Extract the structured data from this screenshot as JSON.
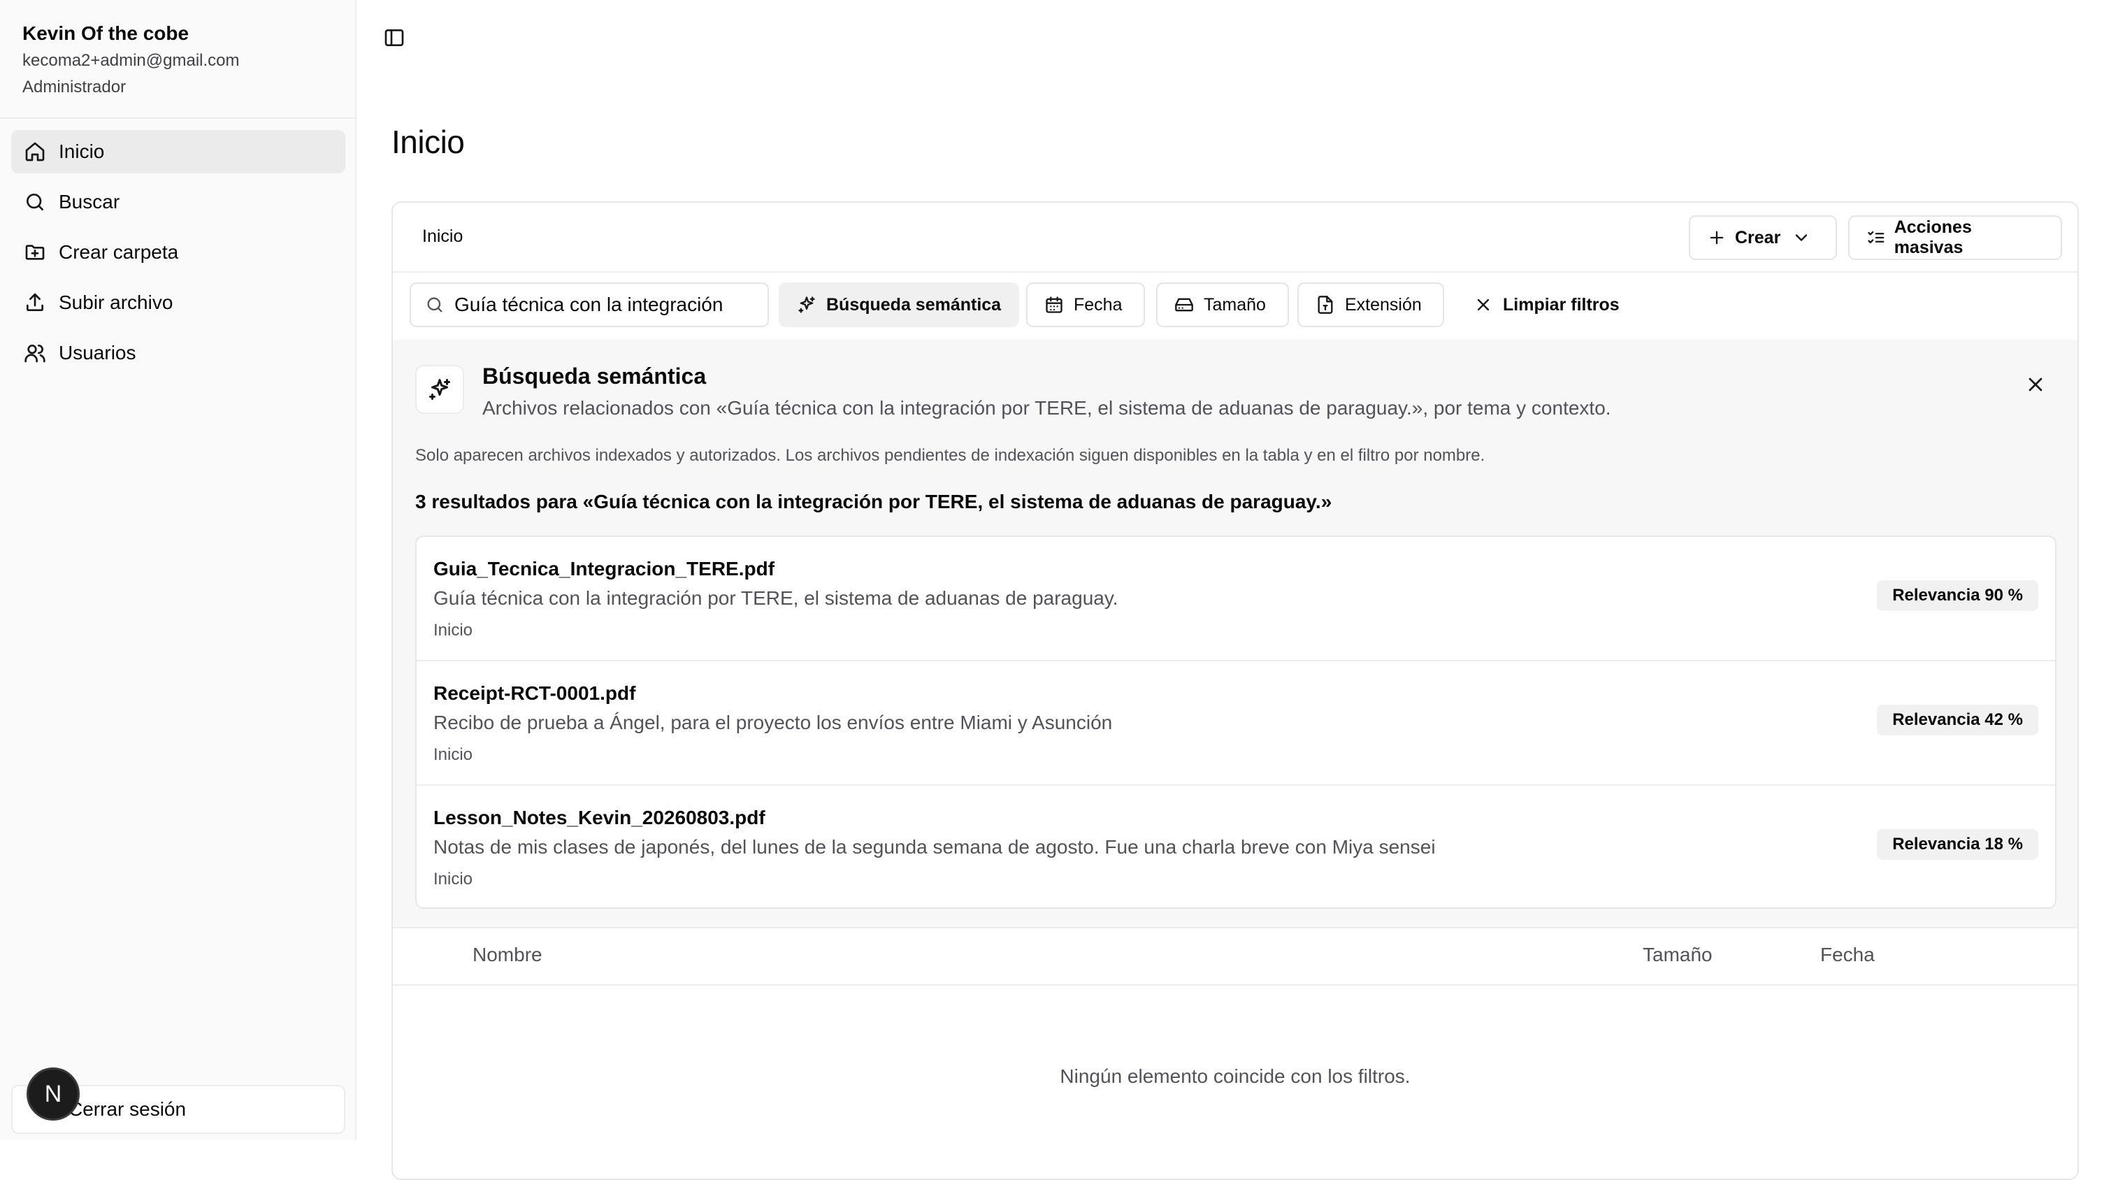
{
  "user": {
    "name": "Kevin Of the cobe",
    "email": "kecoma2+admin@gmail.com",
    "role": "Administrador"
  },
  "sidebar": {
    "items": [
      {
        "label": "Inicio",
        "icon": "home-icon",
        "active": true
      },
      {
        "label": "Buscar",
        "icon": "search-icon"
      },
      {
        "label": "Crear carpeta",
        "icon": "folder-plus-icon"
      },
      {
        "label": "Subir archivo",
        "icon": "upload-icon"
      },
      {
        "label": "Usuarios",
        "icon": "users-icon"
      }
    ],
    "logout_label": "Cerrar sesión",
    "avatar_letter": "N"
  },
  "main": {
    "page_title": "Inicio",
    "breadcrumb": "Inicio",
    "create_label": "Crear",
    "bulk_label": "Acciones masivas",
    "search_value": "Guía técnica con la integración",
    "filters": {
      "semantic": "Búsqueda semántica",
      "date": "Fecha",
      "size": "Tamaño",
      "extension": "Extensión",
      "clear": "Limpiar filtros"
    }
  },
  "semantic": {
    "title": "Búsqueda semántica",
    "subtitle": "Archivos relacionados con «Guía técnica con la integración por TERE, el sistema de aduanas de paraguay.», por tema y contexto.",
    "note": "Solo aparecen archivos indexados y autorizados. Los archivos pendientes de indexación siguen disponibles en la tabla y en el filtro por nombre.",
    "count": "3 resultados para «Guía técnica con la integración por TERE, el sistema de aduanas de paraguay.»",
    "results": [
      {
        "name": "Guia_Tecnica_Integracion_TERE.pdf",
        "description": "Guía técnica con la integración por TERE, el sistema de aduanas de paraguay.",
        "location": "Inicio",
        "relevance": "Relevancia 90 %"
      },
      {
        "name": "Receipt-RCT-0001.pdf",
        "description": "Recibo de prueba a Ángel, para el proyecto los envíos entre Miami y Asunción",
        "location": "Inicio",
        "relevance": "Relevancia 42 %"
      },
      {
        "name": "Lesson_Notes_Kevin_20260803.pdf",
        "description": "Notas de mis clases de japonés, del lunes de la segunda semana de agosto. Fue una charla breve con Miya sensei",
        "location": "Inicio",
        "relevance": "Relevancia 18 %"
      }
    ]
  },
  "table": {
    "columns": [
      "Nombre",
      "Tamaño",
      "Fecha"
    ],
    "empty_message": "Ningún elemento coincide con los filtros."
  }
}
